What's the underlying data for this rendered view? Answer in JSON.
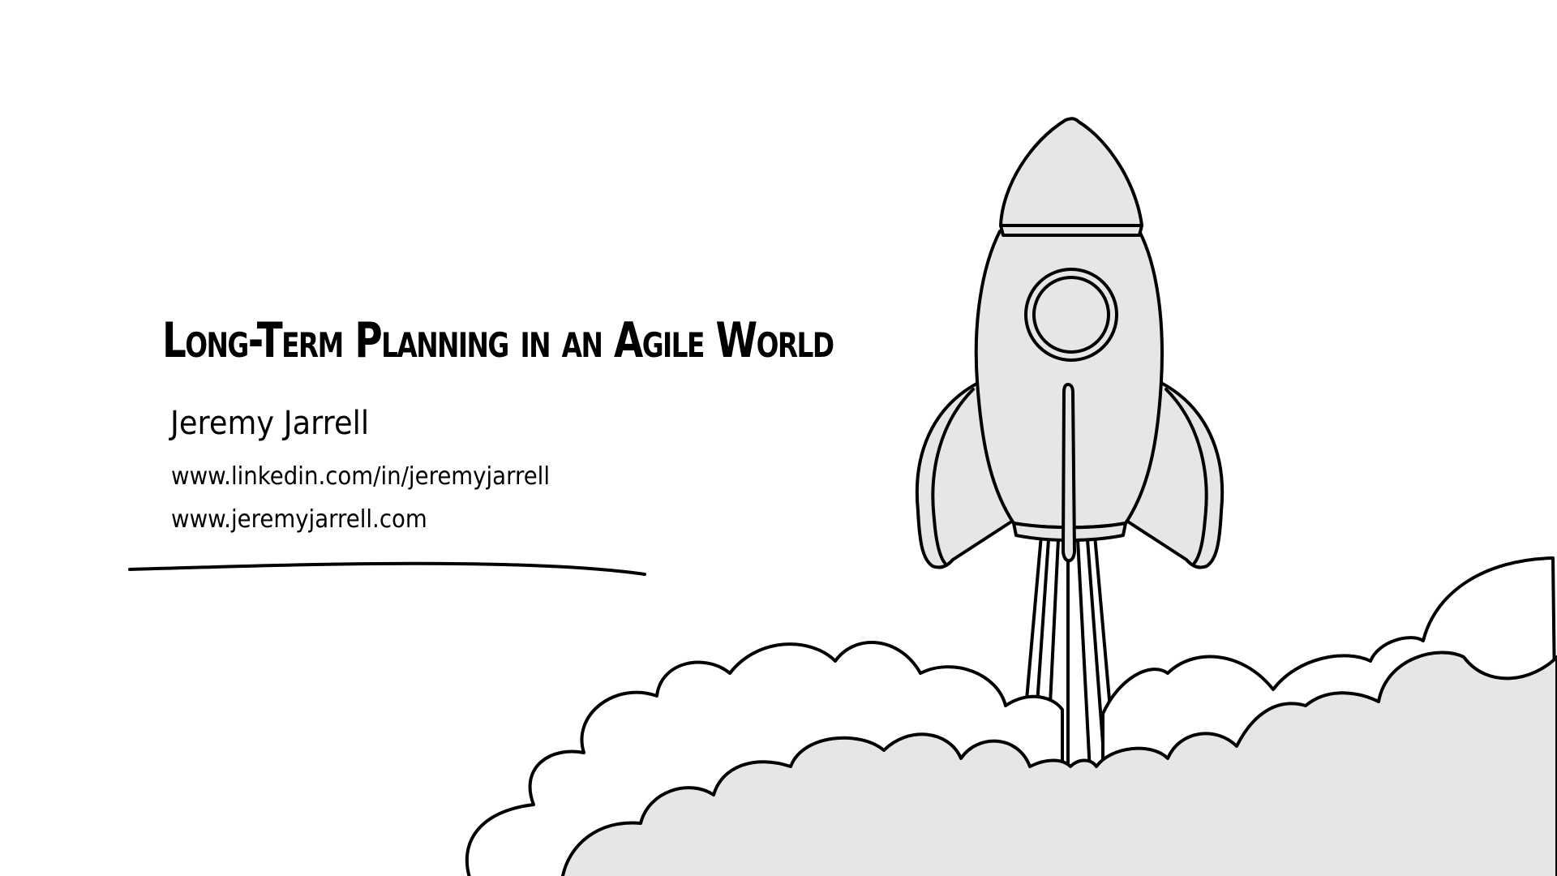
{
  "slide": {
    "title": "Long-Term Planning in an Agile World",
    "author": "Jeremy Jarrell",
    "links": {
      "linkedin": "www.linkedin.com/in/jeremyjarrell",
      "website": "www.jeremyjarrell.com"
    }
  },
  "illustration": {
    "subject": "rocket-launch",
    "icons": [
      "rocket-icon",
      "cloud-icon"
    ]
  },
  "colors": {
    "background": "#ffffff",
    "ink": "#000000",
    "fill": "#e6e6e6"
  }
}
